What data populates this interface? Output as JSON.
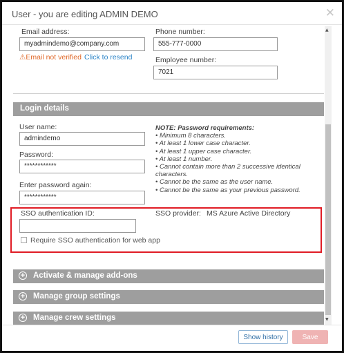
{
  "window": {
    "title": "User - you are editing ADMIN DEMO",
    "close_glyph": "✕"
  },
  "contact": {
    "email_label": "Email address:",
    "email_value": "myadmindemo@company.com",
    "email_warning": "⚠Email not verified",
    "resend_link": "Click to resend",
    "phone_label": "Phone number:",
    "phone_value": "555-777-0000",
    "employee_label": "Employee number:",
    "employee_value": "7021"
  },
  "login": {
    "header": "Login details",
    "username_label": "User name:",
    "username_value": "admindemo",
    "password_label": "Password:",
    "password_value": "************",
    "password_again_label": "Enter password again:",
    "password_again_value": "************",
    "note_title": "NOTE: Password requirements:",
    "requirements": [
      "Minimum 8 characters.",
      "At least 1 lower case character.",
      "At least 1 upper case character.",
      "At least 1 number.",
      "Cannot contain more than 2 successive identical characters.",
      "Cannot be the same as the user name.",
      "Cannot be the same as your previous password."
    ]
  },
  "sso": {
    "id_label": "SSO authentication ID:",
    "id_value": "",
    "provider_label": "SSO provider:",
    "provider_value": "MS Azure Active Directory",
    "require_label": "Require SSO authentication for web app",
    "require_checked": false,
    "highlight_color": "#e01b24"
  },
  "sections": [
    {
      "label": "Activate & manage add-ons"
    },
    {
      "label": "Manage group settings"
    },
    {
      "label": "Manage crew settings"
    }
  ],
  "footer": {
    "history_button": "Show history",
    "save_button": "Save"
  },
  "icons": {
    "plus": "plus-circle-icon",
    "close": "close-icon",
    "warning": "warning-icon"
  }
}
